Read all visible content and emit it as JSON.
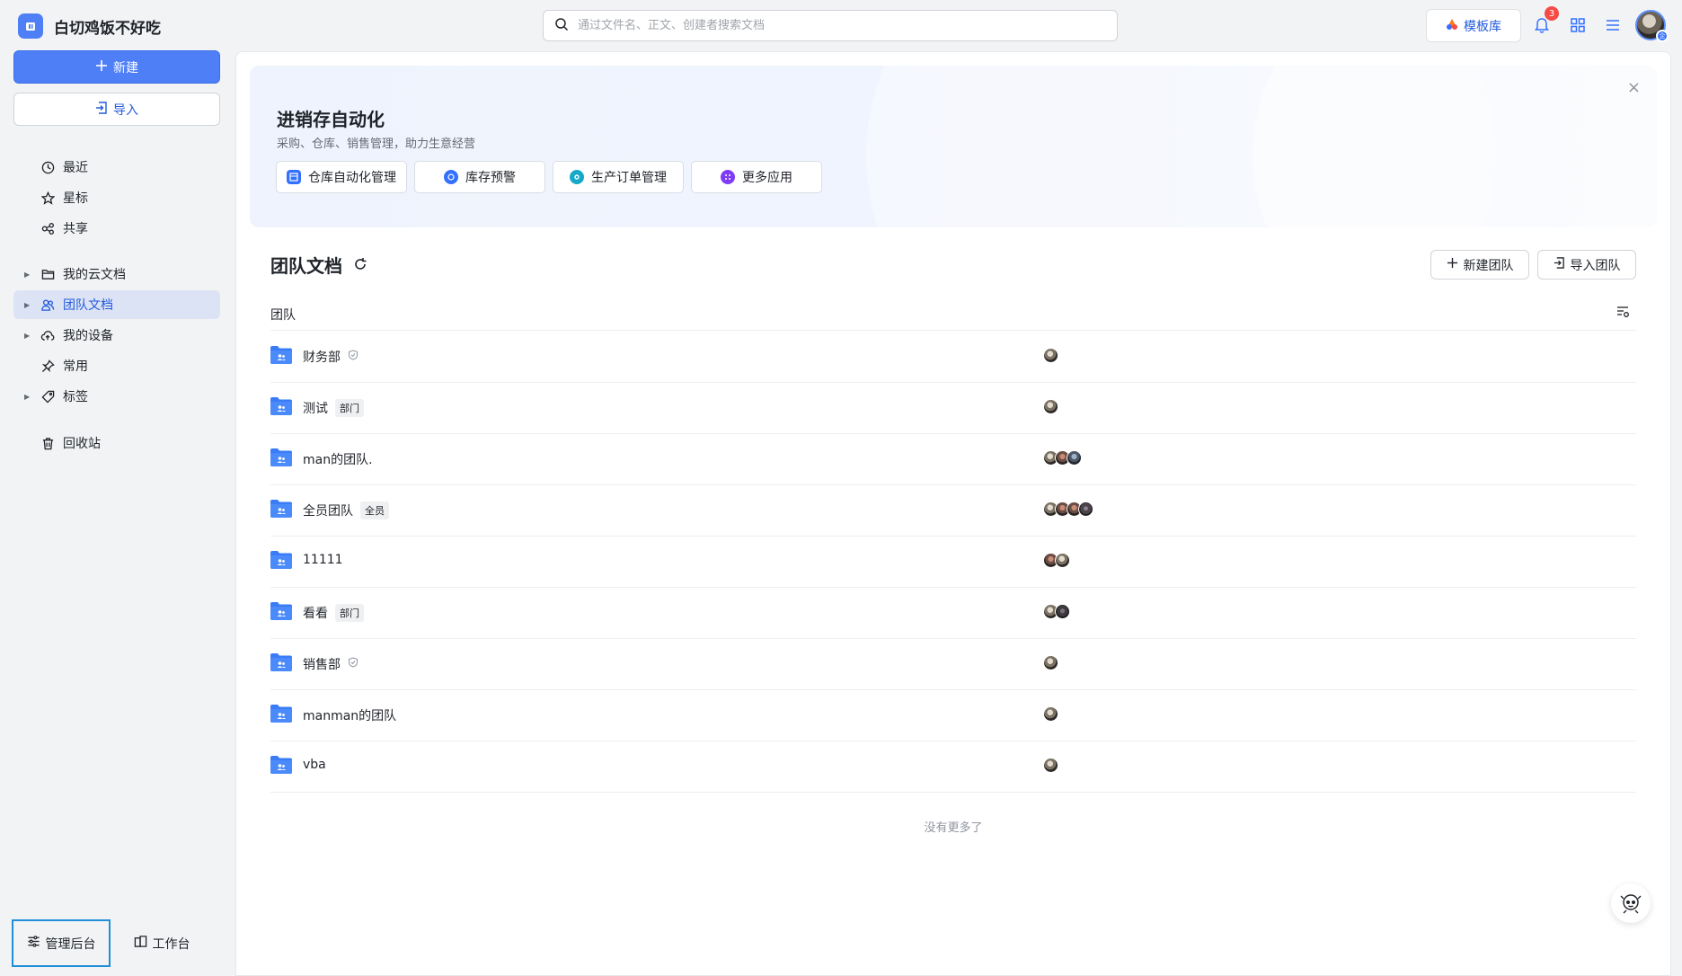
{
  "app": {
    "title": "白切鸡饭不好吃"
  },
  "search": {
    "placeholder": "通过文件名、正文、创建者搜索文档"
  },
  "header": {
    "template_label": "模板库",
    "notification_count": "3",
    "avatar_badge": "企"
  },
  "sidebar": {
    "new_label": "新建",
    "import_label": "导入",
    "items": [
      {
        "label": "最近",
        "icon": "clock-icon"
      },
      {
        "label": "星标",
        "icon": "star-icon"
      },
      {
        "label": "共享",
        "icon": "share-icon"
      },
      {
        "label": "我的云文档",
        "icon": "folder-icon"
      },
      {
        "label": "团队文档",
        "icon": "team-icon",
        "active": true
      },
      {
        "label": "我的设备",
        "icon": "cloud-icon"
      },
      {
        "label": "常用",
        "icon": "pin-icon"
      },
      {
        "label": "标签",
        "icon": "tag-icon"
      },
      {
        "label": "回收站",
        "icon": "trash-icon"
      }
    ],
    "admin_label": "管理后台",
    "workbench_label": "工作台"
  },
  "banner": {
    "title": "进销存自动化",
    "subtitle": "采购、仓库、销售管理，助力生意经营",
    "apps": [
      {
        "label": "仓库自动化管理",
        "color": "#3370ff"
      },
      {
        "label": "库存预警",
        "color": "#3370ff"
      },
      {
        "label": "生产订单管理",
        "color": "#14a9c9"
      },
      {
        "label": "更多应用",
        "color": "#7f3bf5"
      }
    ]
  },
  "team_section": {
    "title": "团队文档",
    "new_team_label": "新建团队",
    "import_team_label": "导入团队",
    "column_header": "团队",
    "footer": "没有更多了",
    "teams": [
      {
        "name": "财务部",
        "tag": "",
        "verified": true,
        "avatars": [
          "c1"
        ]
      },
      {
        "name": "测试",
        "tag": "部门",
        "verified": false,
        "avatars": [
          "c1"
        ]
      },
      {
        "name": "man的团队.",
        "tag": "",
        "verified": false,
        "avatars": [
          "c1",
          "c2",
          "c3"
        ]
      },
      {
        "name": "全员团队",
        "tag": "全员",
        "verified": false,
        "avatars": [
          "c1",
          "c2",
          "c2",
          "c4"
        ]
      },
      {
        "name": "11111",
        "tag": "",
        "verified": false,
        "avatars": [
          "c2",
          "c1"
        ]
      },
      {
        "name": "看看",
        "tag": "部门",
        "verified": false,
        "avatars": [
          "c1",
          "c5"
        ]
      },
      {
        "name": "销售部",
        "tag": "",
        "verified": true,
        "avatars": [
          "c1"
        ]
      },
      {
        "name": "manman的团队",
        "tag": "",
        "verified": false,
        "avatars": [
          "c1"
        ]
      },
      {
        "name": "vba",
        "tag": "",
        "verified": false,
        "avatars": [
          "c1"
        ]
      }
    ]
  }
}
